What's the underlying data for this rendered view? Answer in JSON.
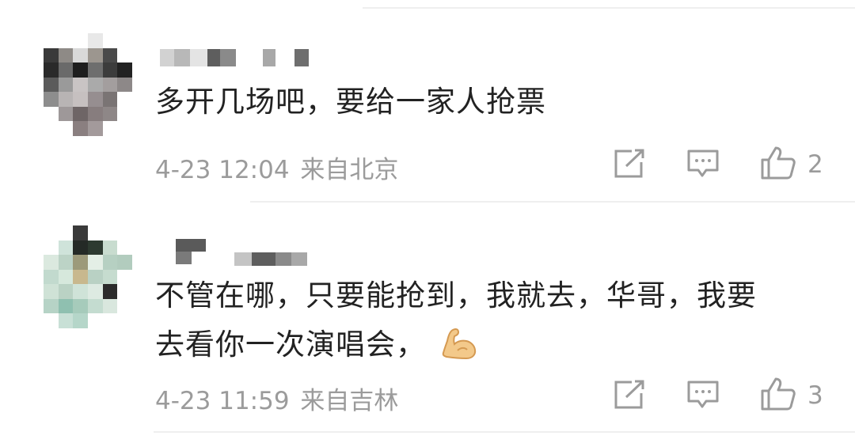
{
  "colors": {
    "text": "#222222",
    "meta": "#9b9b9b",
    "icon": "#9b9b9b",
    "divider": "#efefef"
  },
  "comments": [
    {
      "text_lines": [
        "多开几场吧，要给一家人抢票"
      ],
      "date": "4-23",
      "time": "12:04",
      "location": "来自北京",
      "likes": "2",
      "icons": [
        "share-icon",
        "comment-icon",
        "like-icon"
      ]
    },
    {
      "text_lines": [
        "不管在哪，只要能抢到，我就去，华哥，我要",
        "去看你一次演唱会，"
      ],
      "emoji": "flexed-biceps-emoji",
      "date": "4-23",
      "time": "11:59",
      "location": "来自吉林",
      "likes": "3",
      "icons": [
        "share-icon",
        "comment-icon",
        "like-icon"
      ]
    }
  ]
}
